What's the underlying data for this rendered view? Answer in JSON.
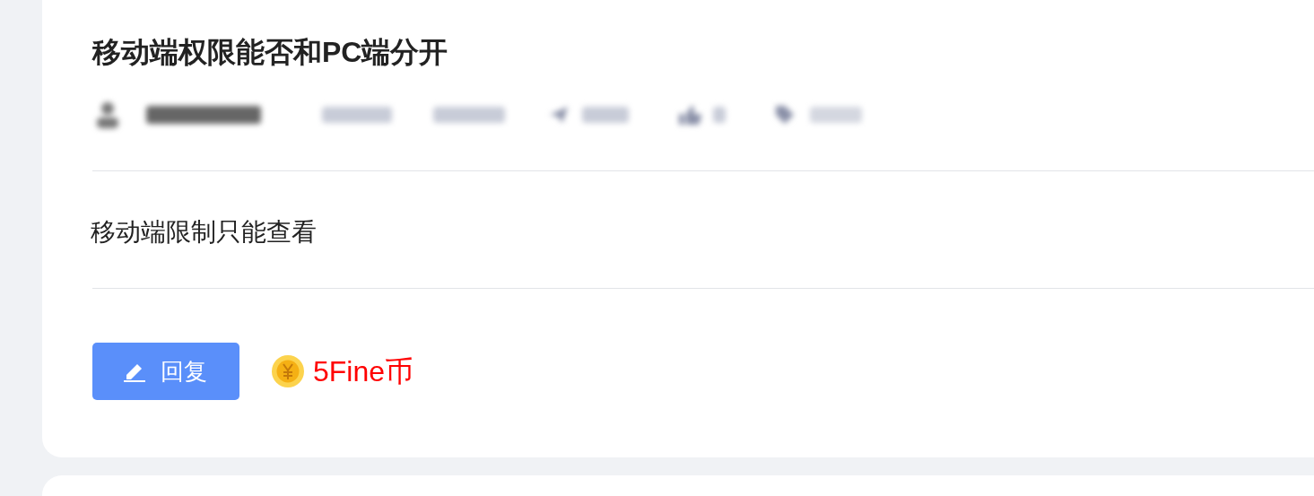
{
  "post": {
    "title": "移动端权限能否和PC端分开",
    "body": "移动端限制只能查看",
    "reply_button": "回复",
    "reward": "5Fine币"
  }
}
